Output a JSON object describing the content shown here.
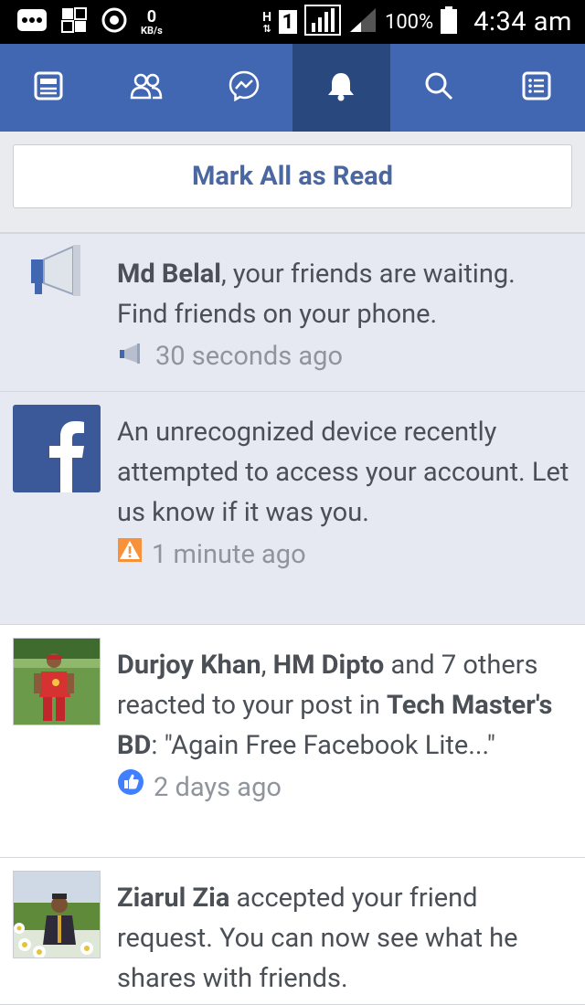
{
  "status_bar": {
    "speed_value": "0",
    "speed_unit": "KB/s",
    "network_type": "H",
    "sim_slot": "1",
    "battery": "100%",
    "time": "4:34 am"
  },
  "nav": {
    "tabs": [
      {
        "icon": "news-feed-icon"
      },
      {
        "icon": "friend-requests-icon"
      },
      {
        "icon": "messenger-icon"
      },
      {
        "icon": "notifications-bell-icon",
        "active": true
      },
      {
        "icon": "search-icon"
      },
      {
        "icon": "menu-icon"
      }
    ]
  },
  "mark_all": {
    "label": "Mark All as Read"
  },
  "notifications": [
    {
      "name": "Md Belal",
      "text": ", your friends are waiting. Find friends on your phone.",
      "time": "30 seconds ago",
      "icon": "megaphone-icon"
    },
    {
      "text": "An unrecognized device recently attempted to access your account. Let us know if it was you.",
      "time": "1 minute ago",
      "icon": "facebook-logo-icon"
    },
    {
      "name1": "Durjoy Khan",
      "sep": ", ",
      "name2": "HM Dipto",
      "mid": " and 7 others reacted to your post in ",
      "group": "Tech Master's BD",
      "quote": ": \"Again Free Facebook Lite...\"",
      "time": "2 days ago"
    },
    {
      "name": "Ziarul Zia",
      "text": " accepted your friend request. You can now see what he shares with friends."
    }
  ],
  "colors": {
    "brand": "#4267b2",
    "active_tab": "#29487d",
    "unread_bg": "#e6e9f2",
    "mark_all_text": "#4b67a1"
  }
}
